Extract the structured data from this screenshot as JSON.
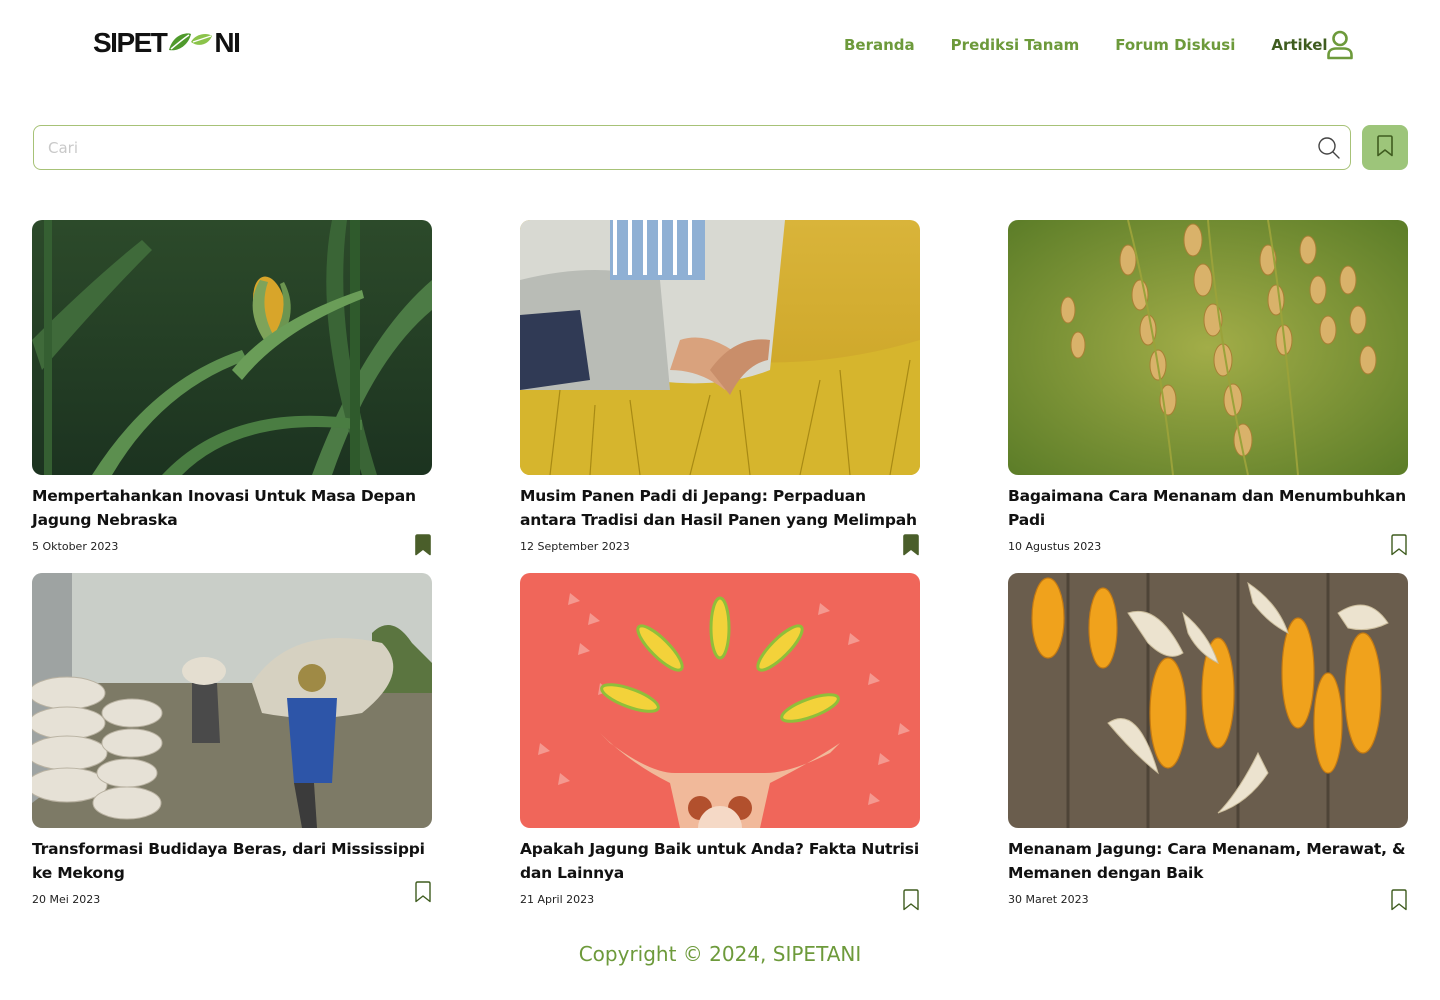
{
  "brand": {
    "logo_left": "SIPET",
    "logo_right": "NI"
  },
  "nav": {
    "items": [
      {
        "label": "Beranda"
      },
      {
        "label": "Prediksi Tanam"
      },
      {
        "label": "Forum Diskusi"
      },
      {
        "label": "Artikel"
      }
    ],
    "active": "Artikel"
  },
  "search": {
    "placeholder": "Cari",
    "value": ""
  },
  "articles": [
    {
      "title": "Mempertahankan Inovasi Untuk Masa Depan Jagung Nebraska",
      "date": "5 Oktober 2023",
      "bookmarked": true,
      "image": "corn-plant-field"
    },
    {
      "title": "Musim Panen Padi di Jepang: Perpaduan antara Tradisi dan Hasil Panen yang Melimpah",
      "date": "12 September 2023",
      "bookmarked": true,
      "image": "farmer-harvest-rice"
    },
    {
      "title": "Bagaimana Cara Menanam dan Menumbuhkan Padi",
      "date": "10 Agustus 2023",
      "bookmarked": false,
      "image": "rice-grains-closeup"
    },
    {
      "title": "Transformasi Budidaya Beras, dari Mississippi ke Mekong",
      "date": "20 Mei 2023",
      "bookmarked": false,
      "image": "workers-carrying-rice-sacks"
    },
    {
      "title": "Apakah Jagung Baik untuk Anda? Fakta Nutrisi dan Lainnya",
      "date": "21 April 2023",
      "bookmarked": false,
      "image": "corn-illustration-red"
    },
    {
      "title": "Menanam Jagung: Cara Menanam, Merawat, & Memanen dengan Baik",
      "date": "30 Maret 2023",
      "bookmarked": false,
      "image": "dried-corn-cobs"
    }
  ],
  "footer": {
    "copyright": "Copyright © 2024, SIPETANI"
  },
  "colors": {
    "primary": "#6d9a3b",
    "active_nav": "#3f5c1f",
    "bookmark_filled": "#4a5e2a",
    "bookmark_button_bg": "#9dc57a",
    "search_border": "#a7c277"
  }
}
